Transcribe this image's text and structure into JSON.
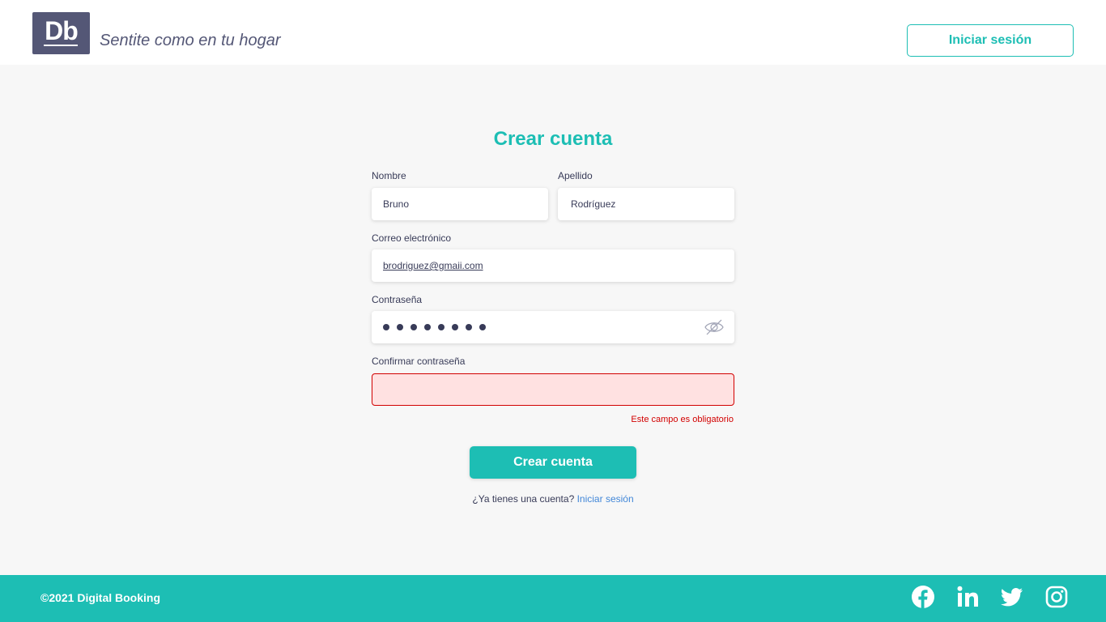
{
  "header": {
    "logo_text": "Db",
    "tagline": "Sentite como en tu hogar",
    "login_button": "Iniciar sesión"
  },
  "form": {
    "title": "Crear cuenta",
    "nombre": {
      "label": "Nombre",
      "value": "Bruno"
    },
    "apellido": {
      "label": "Apellido",
      "value": "Rodríguez"
    },
    "email": {
      "label": "Correo electrónico",
      "value": "brodriguez@gmaii.com"
    },
    "password": {
      "label": "Contraseña",
      "masked_length": 8
    },
    "confirm_password": {
      "label": "Confirmar contraseña",
      "value": "",
      "error": "Este campo es obligatorio"
    },
    "submit_button": "Crear cuenta",
    "have_account_text": "¿Ya tienes una cuenta?",
    "login_link": "Iniciar sesión"
  },
  "footer": {
    "copyright": "©2021 Digital Booking",
    "social_icons": [
      "facebook-icon",
      "linkedin-icon",
      "twitter-icon",
      "instagram-icon"
    ]
  },
  "colors": {
    "primary": "#1dbeb4",
    "secondary": "#545776",
    "text": "#383b58",
    "error": "#d20000",
    "error_bg": "#ffe1e1",
    "link": "#4287d8"
  }
}
